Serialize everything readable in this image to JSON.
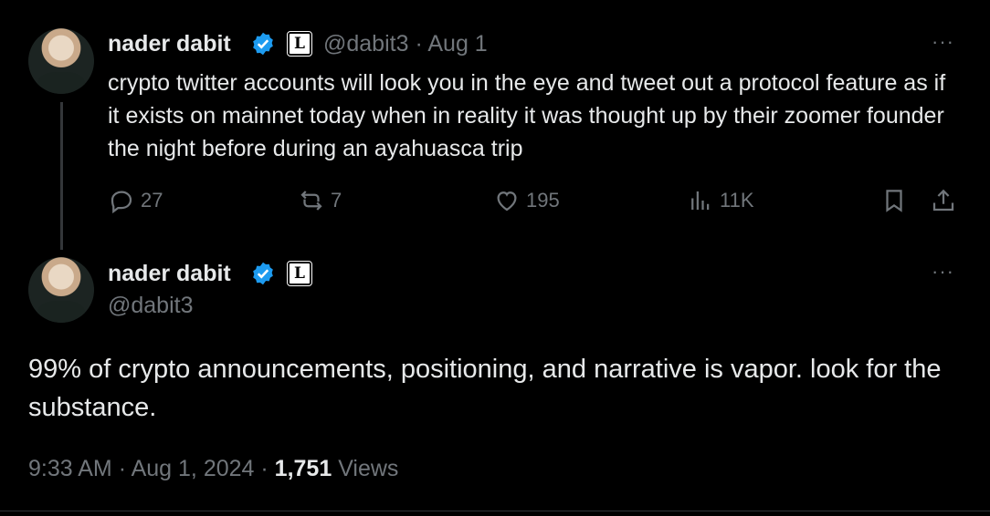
{
  "reply_parent": {
    "author_name": "nader dabit",
    "handle": "@dabit3",
    "separator": "·",
    "date": "Aug 1",
    "text": "crypto twitter accounts will look you in the eye and tweet out a protocol feature as if it exists on mainnet today when in reality it was thought up by their zoomer founder the night before during an ayahuasca trip",
    "more_label": "···",
    "stats": {
      "replies": "27",
      "reposts": "7",
      "likes": "195",
      "views": "11K"
    }
  },
  "main_tweet": {
    "author_name": "nader dabit",
    "handle": "@dabit3",
    "more_label": "···",
    "text": "99% of crypto announcements, positioning, and narrative is vapor. look for the substance.",
    "time": "9:33 AM",
    "sep1": "·",
    "date": "Aug 1, 2024",
    "sep2": "·",
    "views_count": "1,751",
    "views_label": "Views"
  },
  "affiliate_badge_glyph": "L",
  "colors": {
    "background": "#000000",
    "text_primary": "#e7e9ea",
    "text_secondary": "#71767b",
    "verified_blue": "#1d9bf0"
  },
  "icons": [
    "verified-badge-icon",
    "affiliate-badge-icon",
    "more-icon",
    "reply-icon",
    "repost-icon",
    "like-icon",
    "views-icon",
    "bookmark-icon",
    "share-icon"
  ]
}
